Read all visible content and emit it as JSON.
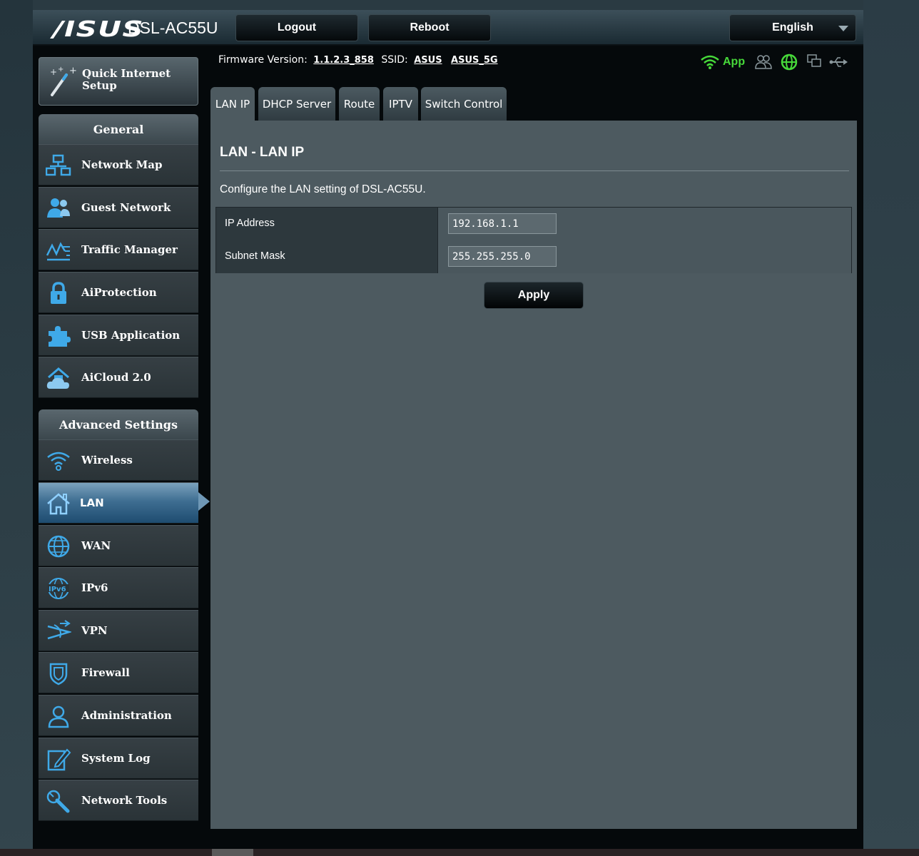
{
  "brand": {
    "logo": "/ISUS",
    "model": "DSL-AC55U"
  },
  "header": {
    "logout_label": "Logout",
    "reboot_label": "Reboot",
    "language_label": "English"
  },
  "status": {
    "firmware_label": "Firmware Version:",
    "firmware_version": "1.1.2.3_858",
    "ssid_label": "SSID:",
    "ssid_1": "ASUS",
    "ssid_2": "ASUS_5G",
    "app_label": "App"
  },
  "sidebar": {
    "qis_label_line1": "Quick Internet",
    "qis_label_line2": "Setup",
    "general_heading": "General",
    "general_items": [
      {
        "label": "Network Map",
        "icon": "network-map-icon"
      },
      {
        "label": "Guest Network",
        "icon": "guest-network-icon"
      },
      {
        "label": "Traffic Manager",
        "icon": "traffic-manager-icon"
      },
      {
        "label": "AiProtection",
        "icon": "lock-icon"
      },
      {
        "label": "USB Application",
        "icon": "puzzle-icon"
      },
      {
        "label": "AiCloud 2.0",
        "icon": "cloud-home-icon"
      }
    ],
    "advanced_heading": "Advanced Settings",
    "advanced_items": [
      {
        "label": "Wireless",
        "icon": "wifi-icon"
      },
      {
        "label": "LAN",
        "icon": "home-icon"
      },
      {
        "label": "WAN",
        "icon": "globe-icon"
      },
      {
        "label": "IPv6",
        "icon": "ipv6-icon"
      },
      {
        "label": "VPN",
        "icon": "vpn-icon"
      },
      {
        "label": "Firewall",
        "icon": "shield-icon"
      },
      {
        "label": "Administration",
        "icon": "user-icon"
      },
      {
        "label": "System Log",
        "icon": "edit-icon"
      },
      {
        "label": "Network Tools",
        "icon": "tools-icon"
      }
    ]
  },
  "tabs": [
    {
      "label": "LAN IP",
      "active": true
    },
    {
      "label": "DHCP Server"
    },
    {
      "label": "Route"
    },
    {
      "label": "IPTV"
    },
    {
      "label": "Switch Control"
    }
  ],
  "content": {
    "title": "LAN - LAN IP",
    "description": "Configure the LAN setting of DSL-AC55U.",
    "fields": [
      {
        "label": "IP Address",
        "value": "192.168.1.1"
      },
      {
        "label": "Subnet Mask",
        "value": "255.255.255.0"
      }
    ],
    "apply_label": "Apply"
  },
  "colors": {
    "accent_green": "#47d93a",
    "icon_blue": "#3fa9e8",
    "active_blue": "#3f6e92"
  }
}
